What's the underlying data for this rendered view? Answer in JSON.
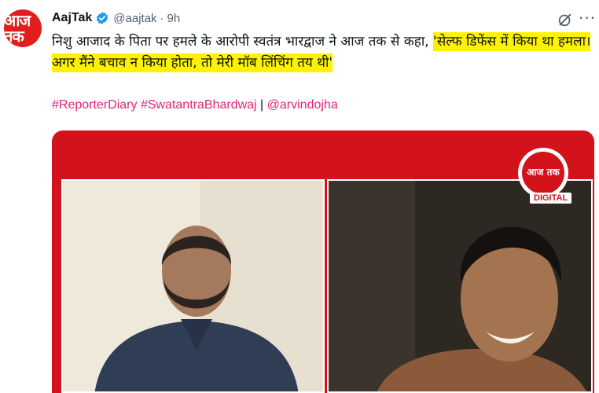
{
  "author": {
    "name": "AajTak",
    "handle": "@aajtak",
    "separator": "·",
    "time": "9h",
    "avatar_text": "आज तक"
  },
  "tweet": {
    "text_plain": "निशु आजाद के पिता पर हमले के आरोपी स्वतंत्र भारद्वाज ने आज तक से कहा, ",
    "text_highlight": "'सेल्फ डिफेंस में किया था हमला। अगर मैंने बचाव न किया होता, तो मेरी मॉब लिंचिंग तय थी'",
    "highlight_color": "#fff200"
  },
  "tags": {
    "tag1": "#ReporterDiary",
    "tag2": "#SwatantraBhardwaj",
    "separator": "|",
    "mention": "@arvindojha",
    "color": "#e0247a"
  },
  "media": {
    "brand_text": "आज तक",
    "badge": "DIGITAL",
    "accent": "#d3131b"
  },
  "icons": {
    "verified": "verified-badge-icon",
    "grok": "grok-icon",
    "more": "more-options-icon"
  },
  "more_glyph": "···"
}
